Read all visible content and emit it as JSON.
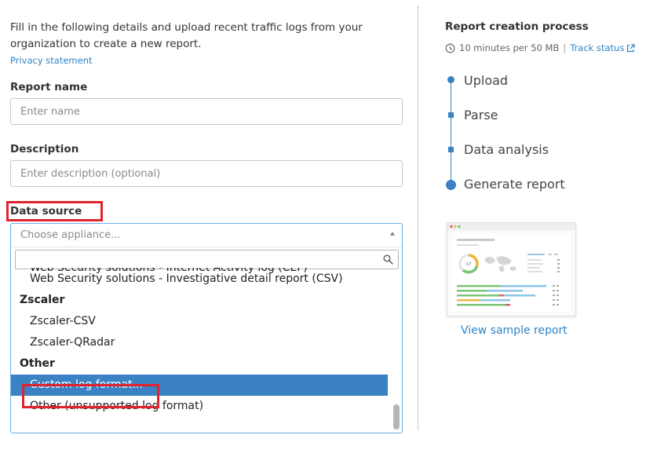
{
  "form": {
    "intro": "Fill in the following details and upload recent traffic logs from your organization to create a new report.",
    "privacy_link": "Privacy statement",
    "report_name": {
      "label": "Report name",
      "placeholder": "Enter name"
    },
    "description": {
      "label": "Description",
      "placeholder": "Enter description (optional)"
    },
    "data_source": {
      "label": "Data source",
      "placeholder": "Choose appliance...",
      "options": [
        {
          "text": "Web Security solutions - Internet Activity log (CEF)",
          "type": "option"
        },
        {
          "text": "Web Security solutions - Investigative detail report (CSV)",
          "type": "option"
        },
        {
          "text": "Zscaler",
          "type": "group"
        },
        {
          "text": "Zscaler-CSV",
          "type": "option"
        },
        {
          "text": "Zscaler-QRadar",
          "type": "option"
        },
        {
          "text": "Other",
          "type": "group"
        },
        {
          "text": "Custom log format...",
          "type": "option",
          "selected": true
        },
        {
          "text": "Other (unsupported log format)",
          "type": "option"
        }
      ]
    }
  },
  "process": {
    "title": "Report creation process",
    "duration": "10 minutes per 50 MB",
    "track_link": "Track status",
    "steps": [
      "Upload",
      "Parse",
      "Data analysis",
      "Generate report"
    ],
    "sample_link": "View sample report",
    "sample_donut_value": "17"
  },
  "colors": {
    "accent": "#3a82c4",
    "link": "#2e84c6",
    "highlight_box": "#e0222e",
    "selected_bg": "#3a82c4"
  },
  "icons": [
    "search-icon",
    "clock-icon",
    "external-link-icon",
    "caret-up-icon"
  ]
}
